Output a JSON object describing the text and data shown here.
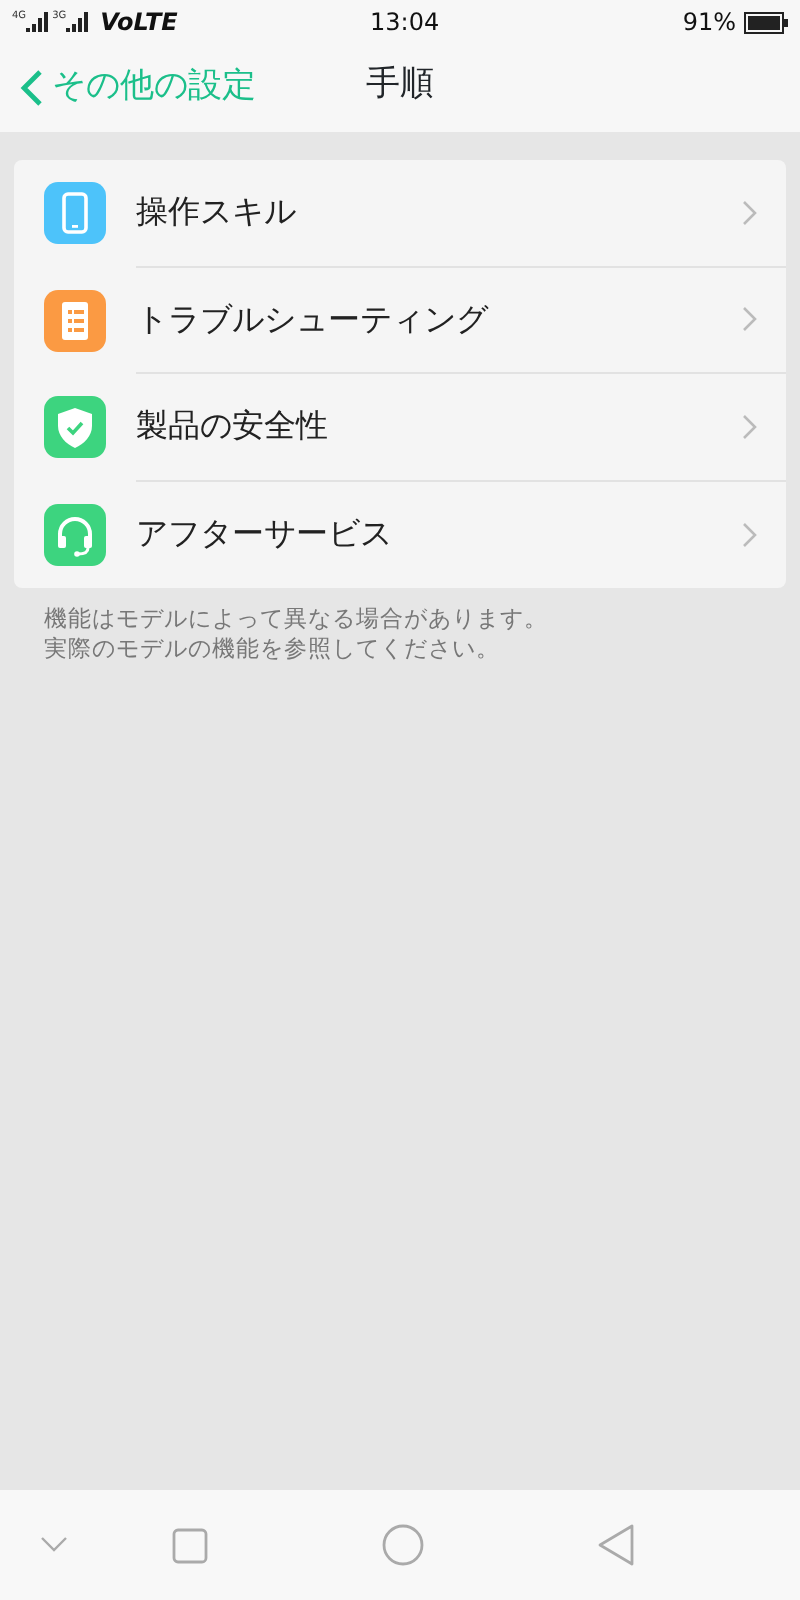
{
  "status_bar": {
    "networks": [
      "4G",
      "3G"
    ],
    "carrier": "VoLTE",
    "time": "13:04",
    "battery": "91%"
  },
  "header": {
    "back_label": "その他の設定",
    "title": "手順"
  },
  "items": [
    {
      "label": "操作スキル",
      "kind": "phone",
      "color": "#4dc3fa"
    },
    {
      "label": "トラブルシューティング",
      "kind": "list",
      "color": "#fb9a43"
    },
    {
      "label": "製品の安全性",
      "kind": "shield",
      "color": "#3dd47f"
    },
    {
      "label": "アフターサービス",
      "kind": "headset",
      "color": "#3dd47f"
    }
  ],
  "note": [
    "機能はモデルによって異なる場合があります。",
    "実際のモデルの機能を参照してください。"
  ]
}
